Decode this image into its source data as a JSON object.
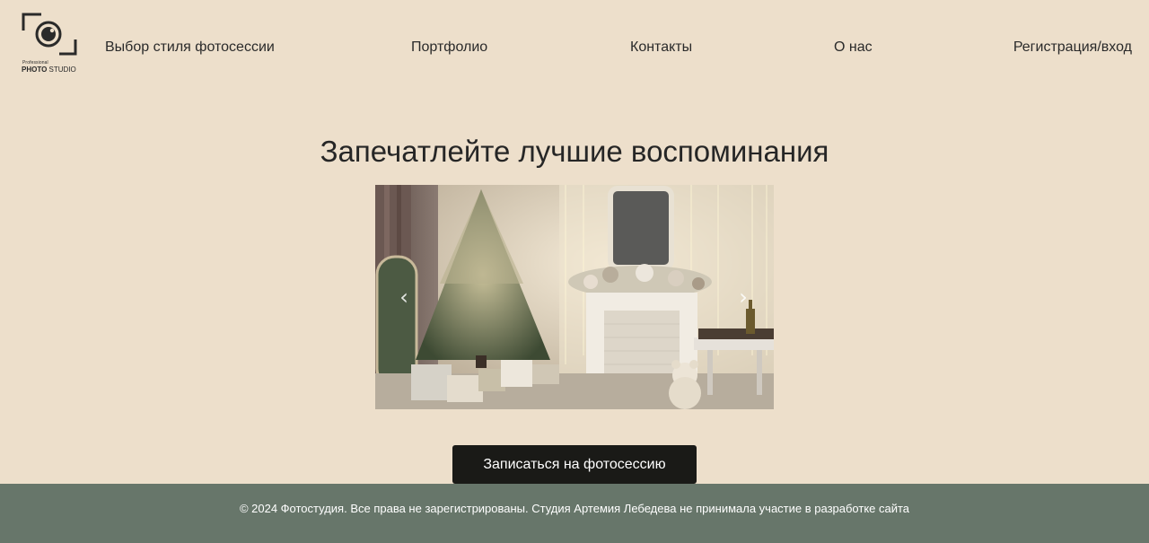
{
  "brand": {
    "logo_small_text": "Professional",
    "logo_text_bold": "PHOTO",
    "logo_text_regular": "STUDIO",
    "icon": "camera-frame-icon"
  },
  "nav": {
    "items": [
      {
        "label": "Выбор стиля фотосессии"
      },
      {
        "label": "Портфолио"
      },
      {
        "label": "Контакты"
      },
      {
        "label": "О нас"
      },
      {
        "label": "Регистрация/вход"
      }
    ]
  },
  "hero": {
    "title": "Запечатлейте лучшие воспоминания",
    "carousel": {
      "image_description": "Christmas-decorated room with tree, fireplace, garlands and teddy bear",
      "prev_icon": "chevron-left-icon",
      "next_icon": "chevron-right-icon",
      "prev_glyph": "‹",
      "next_glyph": "›"
    },
    "cta_label": "Записаться на фотосессию"
  },
  "footer": {
    "text": "© 2024 Фотостудия. Все права не зарегистрированы. Студия Артемия Лебедева не принимала участие в разработке сайта"
  },
  "colors": {
    "background": "#eddfcb",
    "button": "#1a1a17",
    "footer": "#67766a",
    "text": "#2a2a2a"
  }
}
